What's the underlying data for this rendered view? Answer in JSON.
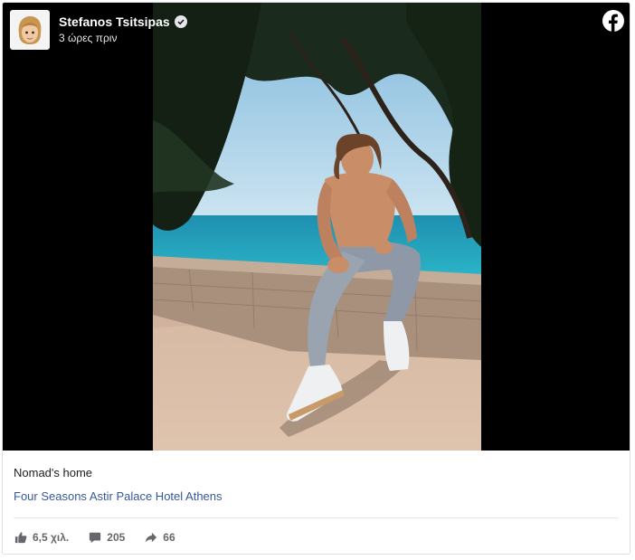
{
  "post": {
    "author_name": "Stefanos Tsitsipas",
    "timestamp": "3 ώρες πριν",
    "caption": "Nomad's home",
    "location": "Four Seasons Astir Palace Hotel Athens"
  },
  "stats": {
    "likes": "6,5 χιλ.",
    "comments": "205",
    "shares": "66"
  },
  "icons": {
    "platform": "facebook-icon",
    "verified": "verified-badge-icon",
    "like": "thumbs-up-icon",
    "comment": "comment-bubble-icon",
    "share": "share-arrow-icon"
  },
  "colors": {
    "link": "#385898",
    "media_background": "#000000",
    "muted_text": "#65676b"
  }
}
